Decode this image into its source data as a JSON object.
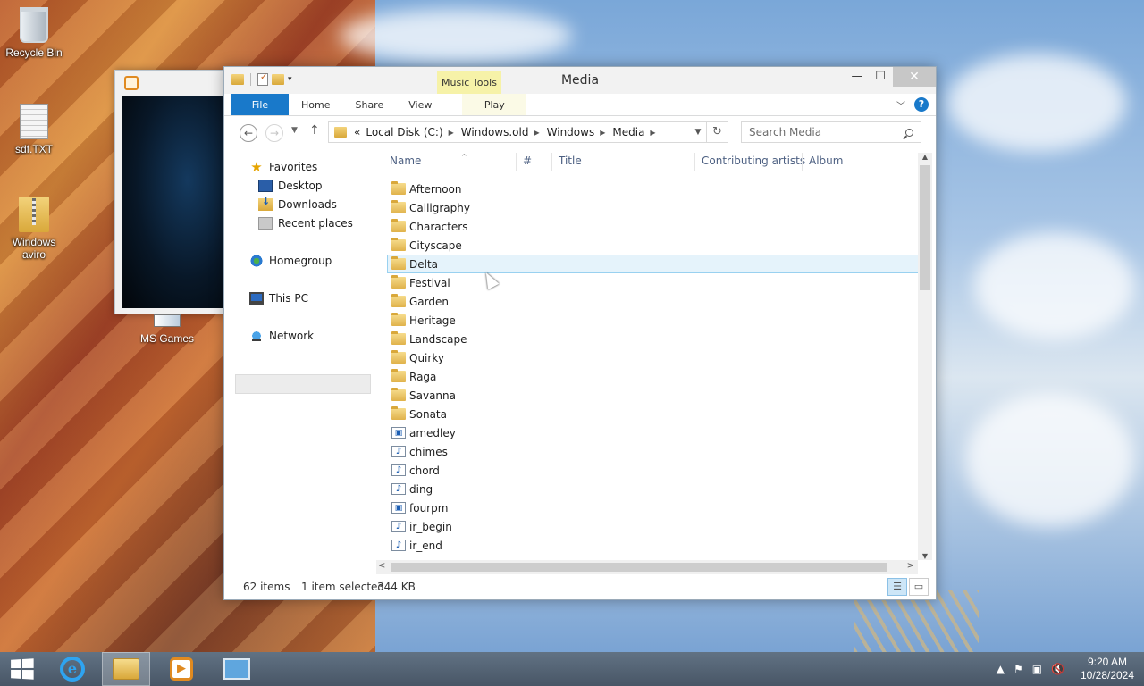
{
  "desktop": {
    "icons": [
      {
        "label": "Recycle Bin",
        "icon": "recycle-bin-icon"
      },
      {
        "label": "sdf.TXT",
        "icon": "text-file-icon"
      },
      {
        "label": "Windows aviro",
        "icon": "zip-folder-icon"
      },
      {
        "label": "MS Games",
        "icon": "shortcut-icon"
      }
    ]
  },
  "explorer": {
    "title": "Media",
    "context_tab": "Music Tools",
    "ribbon_tabs": [
      "File",
      "Home",
      "Share",
      "View",
      "Play"
    ],
    "window_buttons": {
      "minimize": "—",
      "maximize": "☐",
      "close": "✕"
    },
    "address": {
      "overflow": "«",
      "crumbs": [
        "Local Disk (C:)",
        "Windows.old",
        "Windows",
        "Media"
      ]
    },
    "search": {
      "placeholder": "Search Media"
    },
    "nav_pane": {
      "favorites": "Favorites",
      "desktop": "Desktop",
      "downloads": "Downloads",
      "recent": "Recent places",
      "homegroup": "Homegroup",
      "this_pc": "This PC",
      "network": "Network"
    },
    "columns": {
      "name": "Name",
      "number": "#",
      "title": "Title",
      "artists": "Contributing artists",
      "album": "Album"
    },
    "files": [
      {
        "name": "Afternoon",
        "type": "folder"
      },
      {
        "name": "Calligraphy",
        "type": "folder"
      },
      {
        "name": "Characters",
        "type": "folder"
      },
      {
        "name": "Cityscape",
        "type": "folder"
      },
      {
        "name": "Delta",
        "type": "folder",
        "selected": true
      },
      {
        "name": "Festival",
        "type": "folder"
      },
      {
        "name": "Garden",
        "type": "folder"
      },
      {
        "name": "Heritage",
        "type": "folder"
      },
      {
        "name": "Landscape",
        "type": "folder"
      },
      {
        "name": "Quirky",
        "type": "folder"
      },
      {
        "name": "Raga",
        "type": "folder"
      },
      {
        "name": "Savanna",
        "type": "folder"
      },
      {
        "name": "Sonata",
        "type": "folder"
      },
      {
        "name": "amedley",
        "type": "wma"
      },
      {
        "name": "chimes",
        "type": "audio"
      },
      {
        "name": "chord",
        "type": "audio"
      },
      {
        "name": "ding",
        "type": "audio"
      },
      {
        "name": "fourpm",
        "type": "wma"
      },
      {
        "name": "ir_begin",
        "type": "audio"
      },
      {
        "name": "ir_end",
        "type": "audio"
      }
    ],
    "status": {
      "count": "62 items",
      "selection": "1 item selected",
      "size": "344 KB"
    }
  },
  "taskbar": {
    "items": [
      "windows-start",
      "internet-explorer",
      "file-explorer",
      "windows-media-player",
      "control-panel"
    ],
    "clock": {
      "time": "9:20 AM",
      "date": "10/28/2024"
    }
  },
  "colors": {
    "accent": "#1979ca",
    "selection": "#e5f3fb",
    "context_tab": "#f6f2a8"
  }
}
